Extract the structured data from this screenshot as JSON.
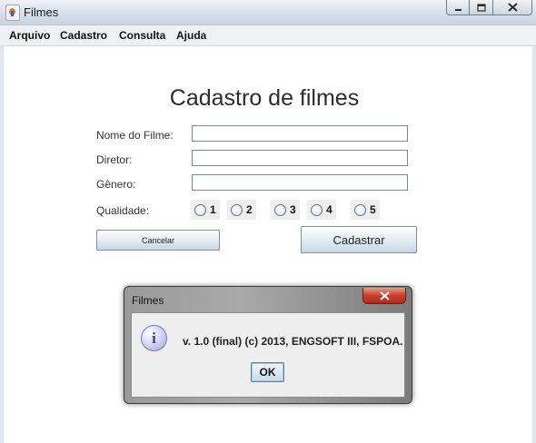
{
  "window": {
    "title": "Filmes"
  },
  "menu": [
    "Arquivo",
    "Cadastro",
    "Consulta",
    "Ajuda"
  ],
  "form": {
    "heading": "Cadastro de filmes",
    "labels": {
      "nome": "Nome do Filme:",
      "diretor": "Diretor:",
      "genero": "Gênero:",
      "qualidade": "Qualidade:"
    },
    "values": {
      "nome": "",
      "diretor": "",
      "genero": ""
    },
    "quality_options": [
      "1",
      "2",
      "3",
      "4",
      "5"
    ],
    "cancel_label": "Cancelar",
    "submit_label": "Cadastrar"
  },
  "dialog": {
    "title": "Filmes",
    "icon": "info-icon",
    "message": "v. 1.0 (final) (c) 2013, ENGSOFT III, FSPOA.",
    "ok_label": "OK"
  }
}
